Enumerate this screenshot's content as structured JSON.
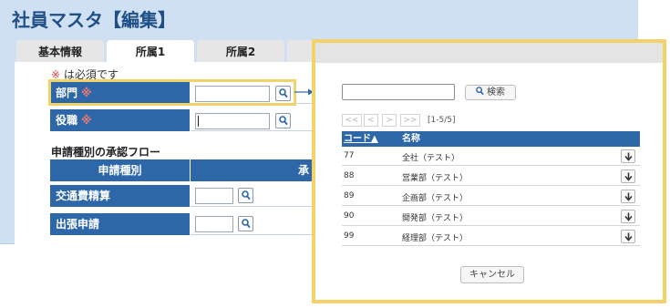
{
  "page": {
    "title": "社員マスタ【編集】"
  },
  "tabs": [
    {
      "label": "基本情報"
    },
    {
      "label": "所属1"
    },
    {
      "label": "所属2"
    },
    {
      "label": ""
    },
    {
      "label": ""
    },
    {
      "label": ""
    }
  ],
  "form": {
    "required_note_star": "※",
    "required_note_text": "は必須です",
    "required_star": "※",
    "fields": [
      {
        "label": "部門",
        "value": ""
      },
      {
        "label": "役職",
        "value": ""
      }
    ],
    "approval_section_title": "申請種別の承認フロー",
    "approval_table": {
      "col1": "申請種別",
      "col2": "承",
      "rows": [
        {
          "label": "交通費精算",
          "value": ""
        },
        {
          "label": "出張申請",
          "value": ""
        }
      ]
    }
  },
  "modal": {
    "search_value": "",
    "search_button": "検索",
    "pager": {
      "first": "<<",
      "prev": "<",
      "next": ">",
      "last": ">>",
      "count": "[1-5/5]"
    },
    "columns": {
      "code": "コード▲",
      "name": "名称"
    },
    "rows": [
      {
        "code": "77",
        "name": "全社（テスト）"
      },
      {
        "code": "88",
        "name": "営業部（テスト）"
      },
      {
        "code": "89",
        "name": "企画部（テスト）"
      },
      {
        "code": "90",
        "name": "開発部（テスト）"
      },
      {
        "code": "99",
        "name": "経理部（テスト）"
      }
    ],
    "cancel_button": "キャンセル"
  },
  "colors": {
    "header_blue": "#2d67a8",
    "title_blue": "#1f4f86",
    "highlight_yellow": "#f1d36a",
    "required_red": "#e0433c"
  },
  "icons": {
    "search": "search-icon",
    "arrow": "arrow-right-icon",
    "select": "arrow-down-icon"
  }
}
